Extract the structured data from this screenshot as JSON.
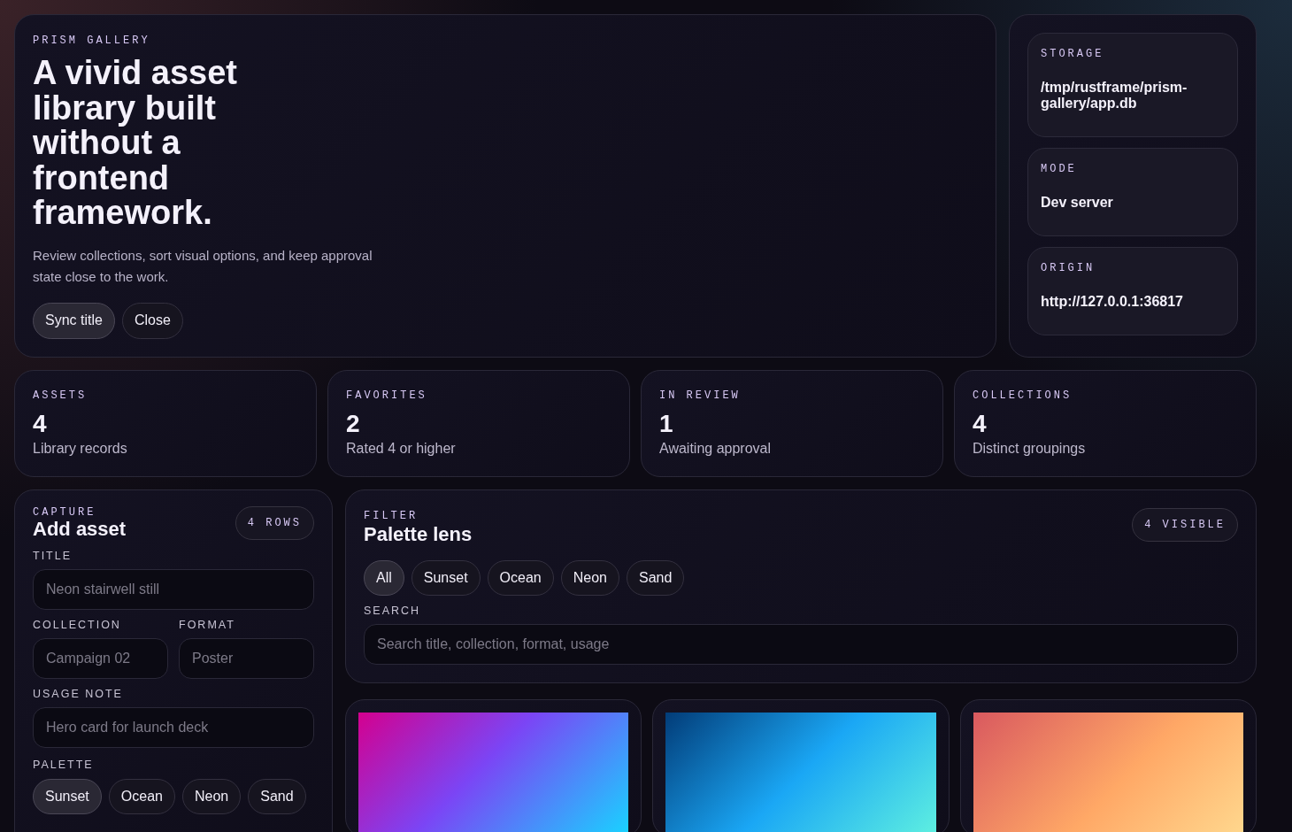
{
  "hero": {
    "eyebrow": "PRISM GALLERY",
    "title": "A vivid asset library built without a frontend framework.",
    "description": "Review collections, sort visual options, and keep approval state close to the work.",
    "buttons": [
      {
        "label": "Sync title",
        "selected": true
      },
      {
        "label": "Close",
        "selected": false
      }
    ]
  },
  "info_cards": [
    {
      "label": "STORAGE",
      "value": "/tmp/rustframe/prism-gallery/app.db"
    },
    {
      "label": "MODE",
      "value": "Dev server"
    },
    {
      "label": "ORIGIN",
      "value": "http://127.0.0.1:36817"
    }
  ],
  "stats": [
    {
      "label": "ASSETS",
      "value": "4",
      "caption": "Library records"
    },
    {
      "label": "FAVORITES",
      "value": "2",
      "caption": "Rated 4 or higher"
    },
    {
      "label": "IN REVIEW",
      "value": "1",
      "caption": "Awaiting approval"
    },
    {
      "label": "COLLECTIONS",
      "value": "4",
      "caption": "Distinct groupings"
    }
  ],
  "capture": {
    "eyebrow": "CAPTURE",
    "title": "Add asset",
    "badge": "4 ROWS",
    "fields": [
      {
        "label": "TITLE",
        "placeholder": "Neon stairwell still"
      }
    ],
    "pair_fields": [
      {
        "label": "COLLECTION",
        "placeholder": "Campaign 02"
      },
      {
        "label": "FORMAT",
        "placeholder": "Poster"
      }
    ],
    "note_field": {
      "label": "USAGE NOTE",
      "placeholder": "Hero card for launch deck"
    },
    "palette_label": "PALETTE",
    "palette": [
      {
        "label": "Sunset",
        "selected": true
      },
      {
        "label": "Ocean",
        "selected": false
      },
      {
        "label": "Neon",
        "selected": false
      },
      {
        "label": "Sand",
        "selected": false
      }
    ]
  },
  "filter": {
    "eyebrow": "FILTER",
    "title": "Palette lens",
    "badge": "4 VISIBLE",
    "chips": [
      {
        "label": "All",
        "selected": true
      },
      {
        "label": "Sunset",
        "selected": false
      },
      {
        "label": "Ocean",
        "selected": false
      },
      {
        "label": "Neon",
        "selected": false
      },
      {
        "label": "Sand",
        "selected": false
      }
    ],
    "search_label": "SEARCH",
    "search_placeholder": "Search title, collection, format, usage"
  },
  "gallery": [
    {
      "kind": "neon"
    },
    {
      "kind": "ocean"
    },
    {
      "kind": "sunset"
    }
  ]
}
